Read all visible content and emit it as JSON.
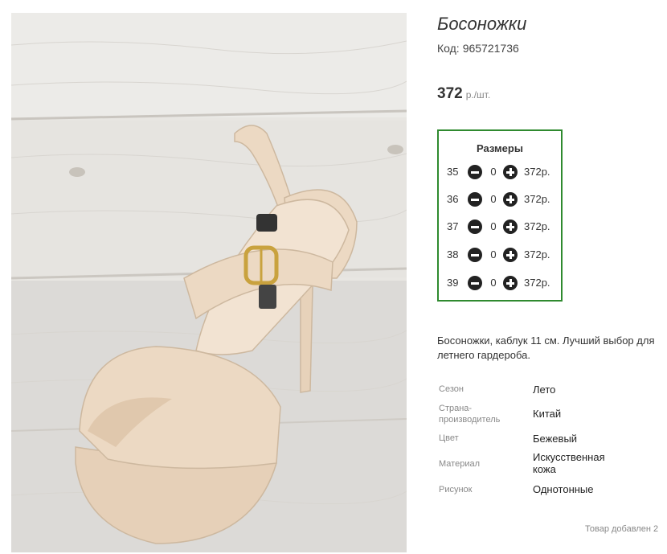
{
  "product": {
    "title": "Босоножки",
    "code_label": "Код:",
    "code_value": "965721736",
    "price_value": "372",
    "price_unit": "р./шт."
  },
  "sizes": {
    "header": "Размеры",
    "rows": [
      {
        "size": "35",
        "qty": "0",
        "price": "372р."
      },
      {
        "size": "36",
        "qty": "0",
        "price": "372р."
      },
      {
        "size": "37",
        "qty": "0",
        "price": "372р."
      },
      {
        "size": "38",
        "qty": "0",
        "price": "372р."
      },
      {
        "size": "39",
        "qty": "0",
        "price": "372р."
      }
    ]
  },
  "description": {
    "line1": "Босоножки, каблук 11 см. Лучший выбор для",
    "line2": "летнего гардероба."
  },
  "properties": [
    {
      "key_lines": [
        "Сезон"
      ],
      "value_lines": [
        "Лето"
      ]
    },
    {
      "key_lines": [
        "Страна-",
        "производитель"
      ],
      "value_lines": [
        "Китай"
      ]
    },
    {
      "key_lines": [
        "Цвет"
      ],
      "value_lines": [
        "Бежевый"
      ]
    },
    {
      "key_lines": [
        "Материал"
      ],
      "value_lines": [
        "Искусственная",
        "кожа"
      ]
    },
    {
      "key_lines": [
        "Рисунок"
      ],
      "value_lines": [
        "Однотонные"
      ]
    }
  ],
  "footer": {
    "added": "Товар добавлен 2"
  },
  "colors": {
    "size_box_border": "#2f8a2f",
    "shoe": "#ecd9c3",
    "wood": "#e8e6e2"
  },
  "icons": [
    "minus-circle-icon",
    "plus-circle-icon"
  ]
}
